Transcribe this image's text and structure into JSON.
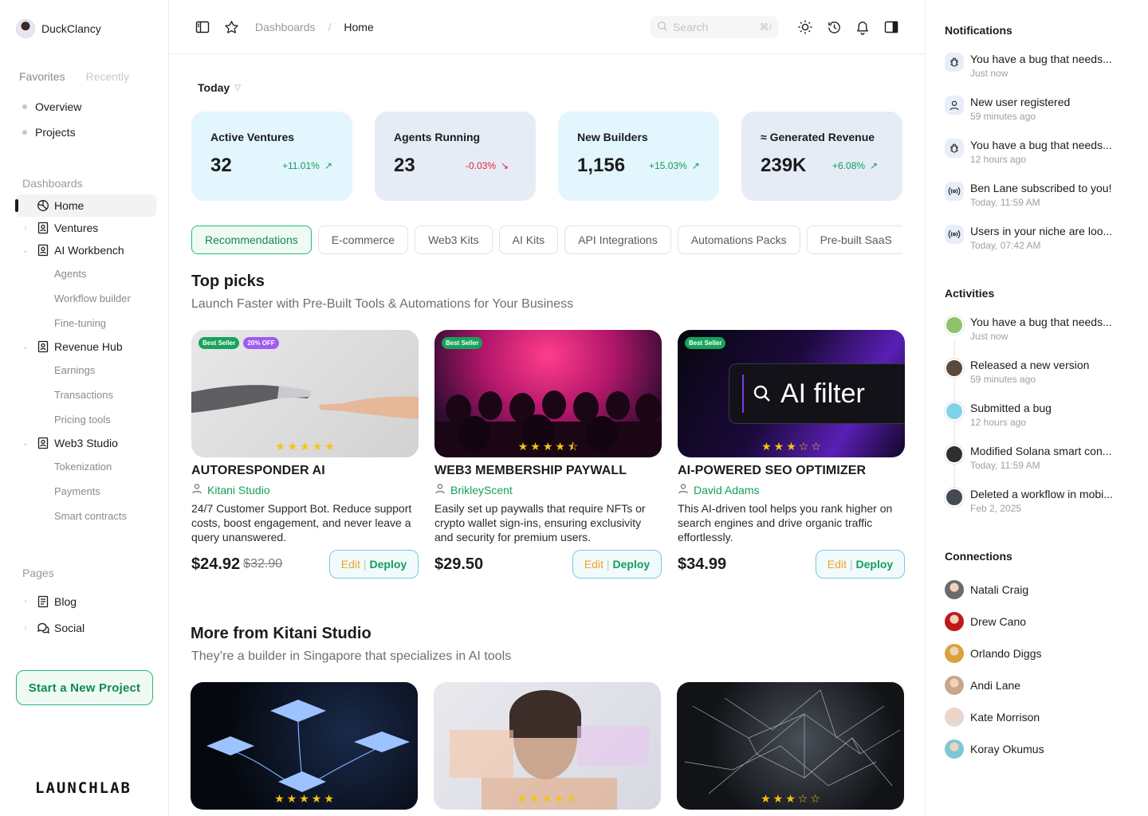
{
  "user": {
    "name": "DuckClancy"
  },
  "favorites": {
    "tabs": [
      "Favorites",
      "Recently"
    ],
    "items": [
      "Overview",
      "Projects"
    ]
  },
  "dashboards": {
    "label": "Dashboards",
    "home": "Home",
    "ventures": "Ventures",
    "ai_workbench": {
      "label": "AI Workbench",
      "children": [
        "Agents",
        "Workflow builder",
        "Fine-tuning"
      ]
    },
    "revenue_hub": {
      "label": "Revenue Hub",
      "children": [
        "Earnings",
        "Transactions",
        "Pricing tools"
      ]
    },
    "web3_studio": {
      "label": "Web3 Studio",
      "children": [
        "Tokenization",
        "Payments",
        "Smart contracts"
      ]
    }
  },
  "pages": {
    "label": "Pages",
    "items": [
      "Blog",
      "Social"
    ]
  },
  "cta": "Start a New Project",
  "logo": "LAUNCHLAB",
  "header": {
    "breadcrumb": [
      "Dashboards",
      "/",
      "Home"
    ],
    "search_placeholder": "Search",
    "search_shortcut": "⌘/"
  },
  "period": "Today",
  "stats": [
    {
      "label": "Active Ventures",
      "value": "32",
      "change": "+11.01%",
      "trend": "up"
    },
    {
      "label": "Agents Running",
      "value": "23",
      "change": "-0.03%",
      "trend": "down"
    },
    {
      "label": "New Builders",
      "value": "1,156",
      "change": "+15.03%",
      "trend": "up"
    },
    {
      "label": "≈ Generated Revenue",
      "value": "239K",
      "change": "+6.08%",
      "trend": "up"
    }
  ],
  "tabs": [
    "Recommendations",
    "E-commerce",
    "Web3 Kits",
    "AI Kits",
    "API Integrations",
    "Automations Packs",
    "Pre-built SaaS"
  ],
  "top_picks": {
    "title": "Top picks",
    "subtitle": "Launch Faster with Pre-Built Tools & Automations for Your Business",
    "cards": [
      {
        "badges": [
          "Best Seller",
          "20% OFF"
        ],
        "rating": 5,
        "title": "AUTORESPONDER AI",
        "author": "Kitani Studio",
        "desc": "24/7 Customer Support Bot. Reduce support costs, boost engagement, and never leave a query unanswered.",
        "price": "$24.92",
        "old_price": "$32.90",
        "edit": "Edit",
        "deploy": "Deploy"
      },
      {
        "badges": [
          "Best Seller"
        ],
        "rating": 4.5,
        "title": "WEB3 MEMBERSHIP PAYWALL",
        "author": "BrikleyScent",
        "desc": "Easily set up paywalls that require NFTs or crypto wallet sign-ins, ensuring exclusivity and security for premium users.",
        "price": "$29.50",
        "old_price": "",
        "edit": "Edit",
        "deploy": "Deploy"
      },
      {
        "badges": [
          "Best Seller"
        ],
        "rating": 3,
        "title": "AI-POWERED SEO OPTIMIZER",
        "author": "David Adams",
        "desc": "This AI-driven tool helps you rank higher on search engines and drive organic traffic effortlessly.",
        "price": "$34.99",
        "old_price": "",
        "edit": "Edit",
        "deploy": "Deploy",
        "thumb_text": "AI filter"
      }
    ]
  },
  "more": {
    "title": "More from Kitani Studio",
    "subtitle": "They’re a builder in Singapore that specializes in AI tools",
    "ratings": [
      5,
      4.5,
      3
    ]
  },
  "notifications": {
    "title": "Notifications",
    "items": [
      {
        "icon": "bug-icon",
        "text": "You have a bug that needs...",
        "time": "Just now"
      },
      {
        "icon": "user-icon",
        "text": "New user registered",
        "time": "59 minutes ago"
      },
      {
        "icon": "bug-icon",
        "text": "You have a bug that needs...",
        "time": "12 hours ago"
      },
      {
        "icon": "broadcast-icon",
        "text": "Ben Lane subscribed to you!",
        "time": "Today, 11:59 AM"
      },
      {
        "icon": "broadcast-icon",
        "text": "Users in your niche are loo...",
        "time": "Today, 07:42 AM"
      }
    ]
  },
  "activities": {
    "title": "Activities",
    "items": [
      {
        "text": "You have a bug that needs...",
        "time": "Just now",
        "color": "#8fc36a"
      },
      {
        "text": "Released a new version",
        "time": "59 minutes ago",
        "color": "#5a4a3e"
      },
      {
        "text": "Submitted a bug",
        "time": "12 hours ago",
        "color": "#7fd3e8"
      },
      {
        "text": "Modified Solana smart con...",
        "time": "Today, 11:59 AM",
        "color": "#2f2f2f"
      },
      {
        "text": "Deleted a workflow in mobi...",
        "time": "Feb 2, 2025",
        "color": "#454a52"
      }
    ]
  },
  "connections": {
    "title": "Connections",
    "items": [
      {
        "name": "Natali Craig",
        "color": "#6b6b6b"
      },
      {
        "name": "Drew Cano",
        "color": "#c0171b"
      },
      {
        "name": "Orlando Diggs",
        "color": "#d9a23a"
      },
      {
        "name": "Andi Lane",
        "color": "#c9a68a"
      },
      {
        "name": "Kate Morrison",
        "color": "#e8d6d3"
      },
      {
        "name": "Koray Okumus",
        "color": "#7fc6d8"
      }
    ]
  }
}
